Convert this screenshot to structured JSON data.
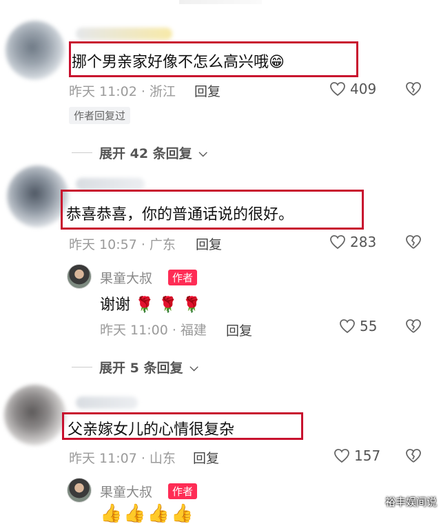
{
  "comments": [
    {
      "text": "挪个男亲家好像不怎么高兴哦",
      "emoji": "😁",
      "meta": "昨天 11:02 · 浙江",
      "reply_label": "回复",
      "likes": "409",
      "author_replied_tag": "作者回复过",
      "expand_label": "展开 42 条回复"
    },
    {
      "text": "恭喜恭喜，你的普通话说的很好。",
      "meta": "昨天 10:57 · 广东",
      "reply_label": "回复",
      "likes": "283",
      "reply": {
        "author": "果童大叔",
        "badge": "作者",
        "text": "谢谢",
        "emojis": "🌹 🌹 🌹",
        "meta": "昨天 11:00 · 福建",
        "reply_label": "回复",
        "likes": "55"
      },
      "expand_label": "展开 5 条回复"
    },
    {
      "text": "父亲嫁女儿的心情很复杂",
      "meta": "昨天 11:07 · 山东",
      "reply_label": "回复",
      "likes": "157",
      "reply": {
        "author": "果童大叔",
        "badge": "作者",
        "emojis": "👍👍👍👍"
      }
    }
  ],
  "watermark": "裕丰娱间说",
  "colors": {
    "highlight_box": "#c8102e",
    "author_badge": "#fe2c55"
  }
}
